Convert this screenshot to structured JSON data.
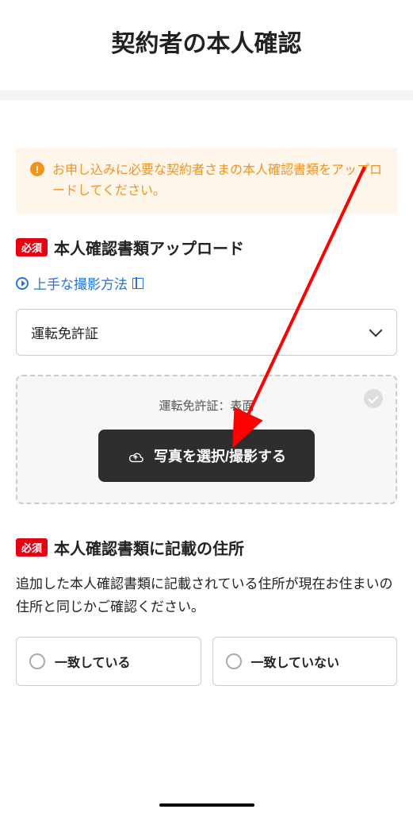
{
  "header": {
    "title": "契約者の本人確認"
  },
  "notice": {
    "text": "お申し込みに必要な契約者さまの本人確認書類をアップロードしてください。"
  },
  "section1": {
    "required_label": "必須",
    "title": "本人確認書類アップロード",
    "hint_link": "上手な撮影方法",
    "dropdown_value": "運転免許証",
    "upload_box_title": "運転免許証：表面",
    "upload_button_label": "写真を選択/撮影する"
  },
  "section2": {
    "required_label": "必須",
    "title": "本人確認書類に記載の住所",
    "description": "追加した本人確認書類に記載されている住所が現在お住まいの住所と同じかご確認ください。",
    "radio_options": [
      "一致している",
      "一致していない"
    ]
  }
}
